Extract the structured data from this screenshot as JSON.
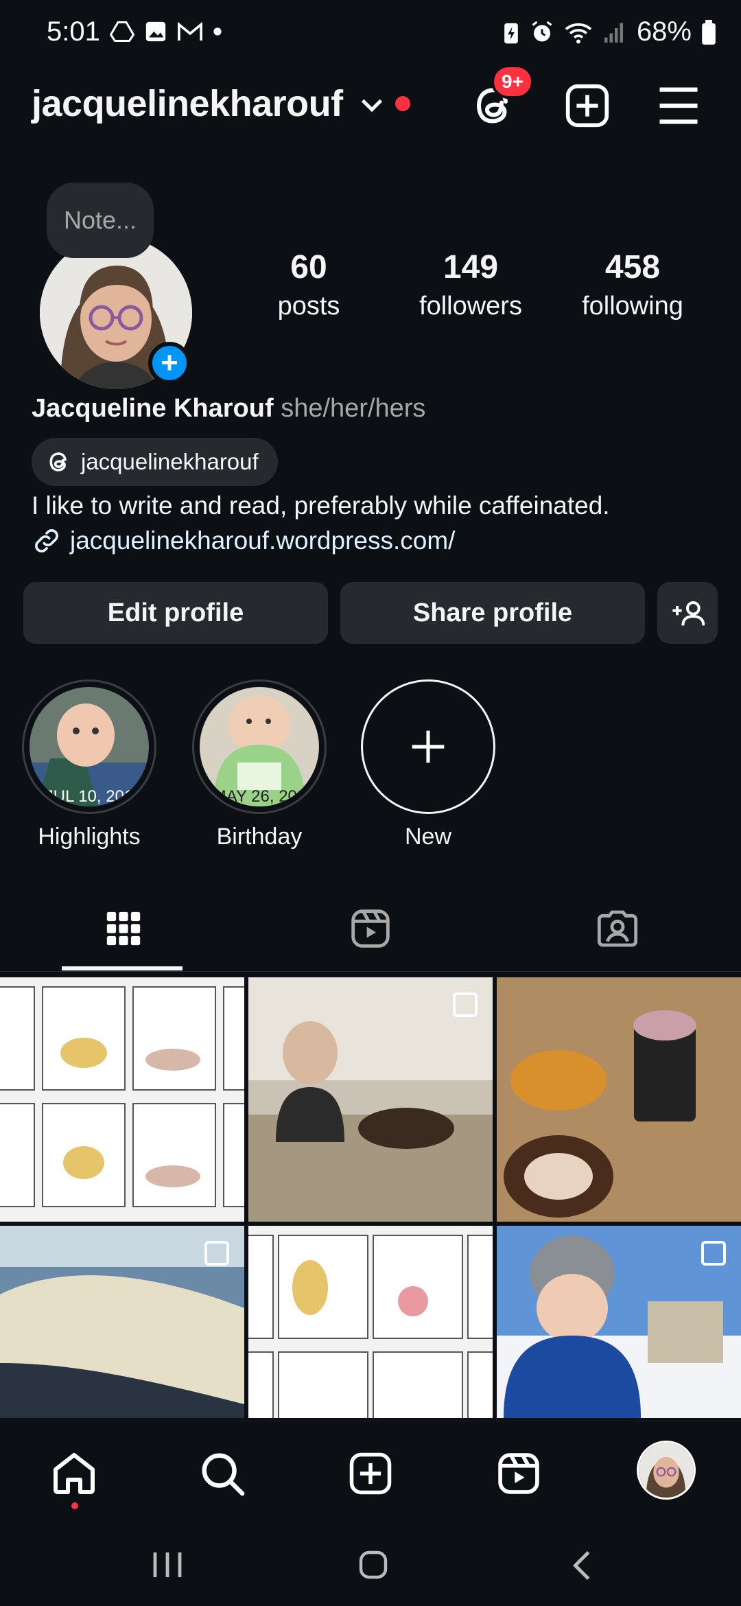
{
  "status_bar": {
    "time": "5:01",
    "battery": "68%",
    "left_icons": [
      "drive-icon",
      "gallery-icon",
      "gmail-icon",
      "dot-icon"
    ],
    "right_icons": [
      "battery-saver-icon",
      "alarm-icon",
      "wifi-icon",
      "signal-icon",
      "battery-icon"
    ]
  },
  "header": {
    "username": "jacquelinekharouf",
    "threads_badge": "9+",
    "icons": [
      "chevron-down-icon",
      "threads-icon",
      "create-icon",
      "menu-icon"
    ]
  },
  "note": {
    "placeholder": "Note..."
  },
  "stats": [
    {
      "count": "60",
      "label": "posts"
    },
    {
      "count": "149",
      "label": "followers"
    },
    {
      "count": "458",
      "label": "following"
    }
  ],
  "profile": {
    "full_name": "Jacqueline Kharouf",
    "pronouns": "she/her/hers",
    "threads_handle": "jacquelinekharouf",
    "bio": "I like to write and read, preferably while caffeinated.",
    "link": "jacquelinekharouf.wordpress.com/"
  },
  "buttons": {
    "edit": "Edit profile",
    "share": "Share profile"
  },
  "highlights": [
    {
      "label": "Highlights",
      "overlay": "JUL 10, 201"
    },
    {
      "label": "Birthday",
      "overlay": "MAY 26, 201"
    },
    {
      "label": "New"
    }
  ],
  "tabs": [
    "grid-icon",
    "reels-icon",
    "tagged-icon"
  ],
  "bottom_nav": [
    "home-icon",
    "search-icon",
    "create-icon",
    "reels-icon",
    "profile-avatar"
  ],
  "colors": {
    "background": "#0c1014",
    "button": "#262a2f",
    "accent_blue": "#0095f6",
    "badge_red": "#ff3040"
  }
}
